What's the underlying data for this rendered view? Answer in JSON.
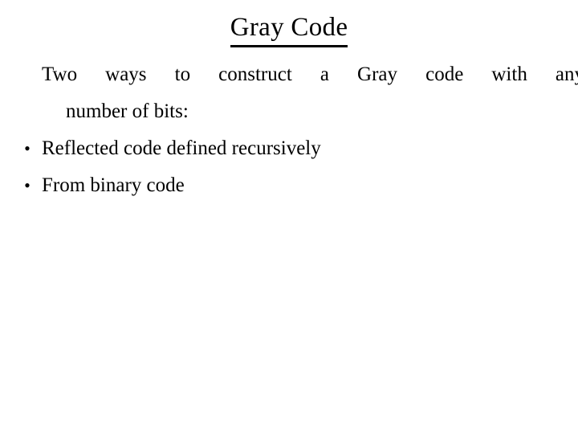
{
  "slide": {
    "title": "Gray Code",
    "background_color": "#ffffff",
    "text_color": "#000000",
    "intro": {
      "line1": "Two ways to construct a Gray code with any",
      "line2": "number of bits:"
    },
    "bullets": [
      {
        "marker": "•",
        "label": "Reflected code defined recursively"
      },
      {
        "marker": "•",
        "label": "From binary code"
      }
    ]
  }
}
